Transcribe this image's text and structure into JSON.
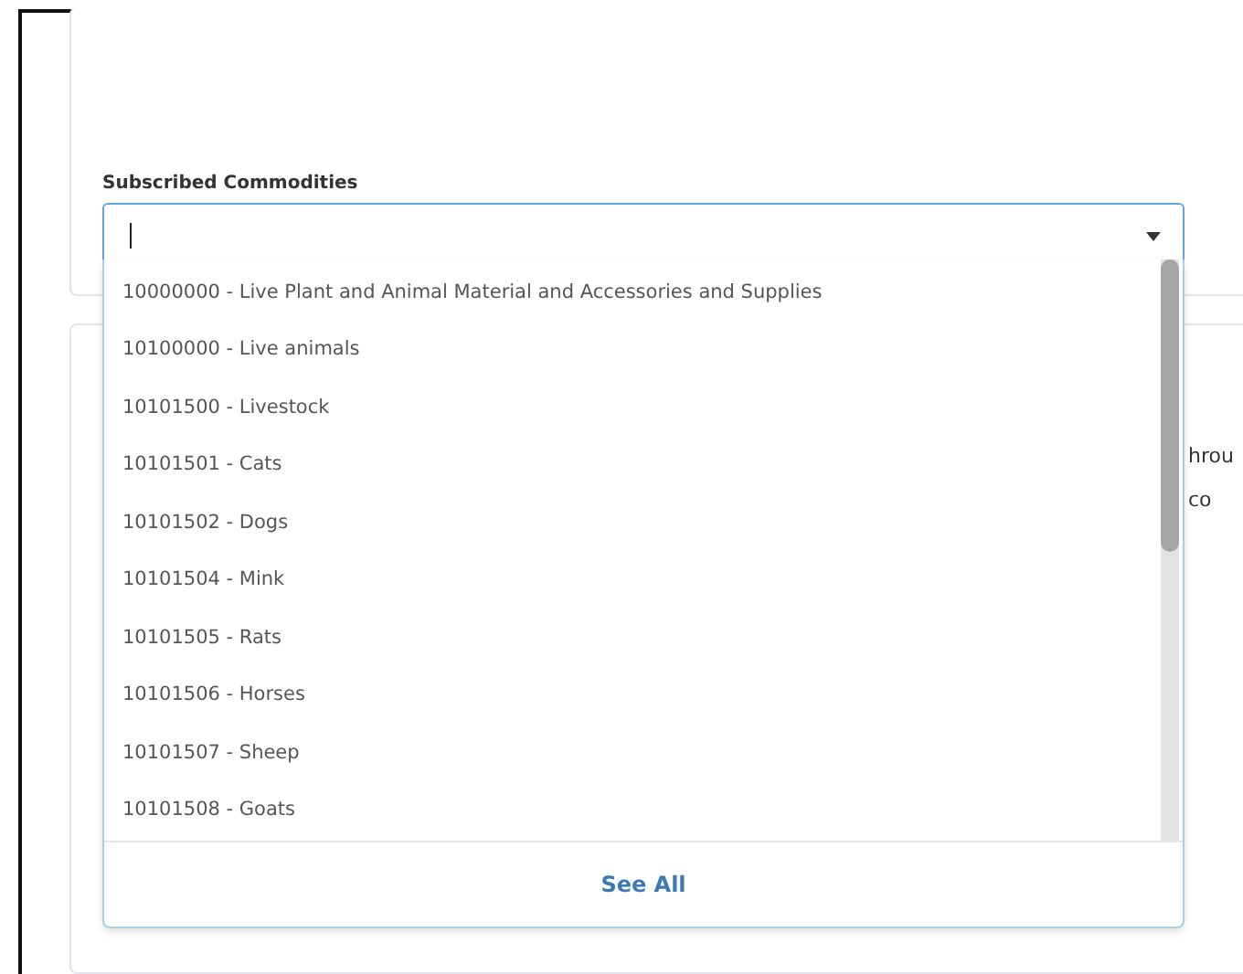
{
  "field": {
    "label": "Subscribed Commodities",
    "focused": true
  },
  "options": [
    {
      "label": "10000000 - Live Plant and Animal Material and Accessories and Supplies"
    },
    {
      "label": "10100000 - Live animals"
    },
    {
      "label": "10101500 - Livestock"
    },
    {
      "label": "10101501 - Cats"
    },
    {
      "label": "10101502 - Dogs"
    },
    {
      "label": "10101504 - Mink"
    },
    {
      "label": "10101505 - Rats"
    },
    {
      "label": "10101506 - Horses"
    },
    {
      "label": "10101507 - Sheep"
    },
    {
      "label": "10101508 - Goats"
    }
  ],
  "footer_link": "See All",
  "background_text": [
    "hrou",
    "co"
  ]
}
